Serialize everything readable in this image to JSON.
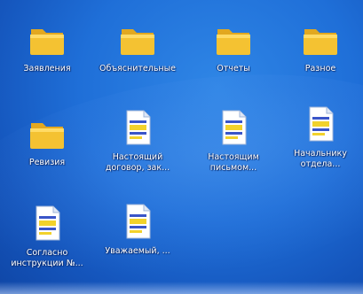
{
  "desktop": {
    "background_color": "#1f6fd8",
    "icons": [
      {
        "label": "Заявления",
        "type": "folder",
        "icon": "folder-icon"
      },
      {
        "label": "Объяснительные",
        "type": "folder",
        "icon": "folder-icon"
      },
      {
        "label": "Отчеты",
        "type": "folder",
        "icon": "folder-icon"
      },
      {
        "label": "Разное",
        "type": "folder",
        "icon": "folder-icon"
      },
      {
        "label": "Ревизия",
        "type": "folder",
        "icon": "folder-icon"
      },
      {
        "label": "Настоящий\nдоговор, зак...",
        "type": "document",
        "icon": "document-icon"
      },
      {
        "label": "Настоящим\nписьмом...",
        "type": "document",
        "icon": "document-icon"
      },
      {
        "label": "Начальнику\nотдела...",
        "type": "document",
        "icon": "document-icon"
      },
      {
        "label": "Согласно\nинструкции №...",
        "type": "document",
        "icon": "document-icon"
      },
      {
        "label": "Уважаемый, ...",
        "type": "document",
        "icon": "document-icon"
      }
    ]
  },
  "colors": {
    "folder_fill": "#f4c232",
    "folder_back": "#e2a820",
    "document_page": "#ffffff",
    "document_highlight": "#f2d22b",
    "document_lines": "#3a55c8"
  }
}
